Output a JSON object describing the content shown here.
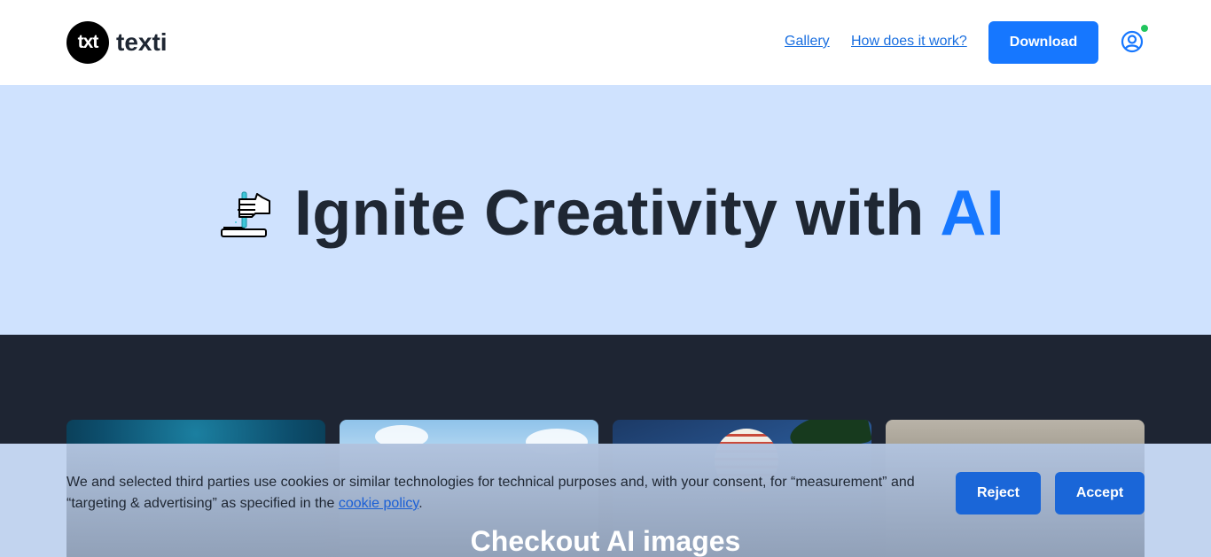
{
  "header": {
    "logo_badge": "txt",
    "logo_name": "texti",
    "nav": {
      "gallery_label": "Gallery",
      "how_label": "How does it work?"
    },
    "download_label": "Download",
    "user_icon": "user-circle-icon",
    "status_color": "#22c55e"
  },
  "hero": {
    "title_main": "Ignite Creativity with ",
    "title_accent": "AI",
    "icon": "hand-writing-icon"
  },
  "gallery": {
    "heading": "Checkout AI images"
  },
  "cookie_banner": {
    "text_before_link": "We and selected third parties use cookies or similar technologies for technical purposes and, with your consent, for “measurement” and “targeting & advertising” as specified in the ",
    "link_label": "cookie policy",
    "text_after_link": ".",
    "reject_label": "Reject",
    "accept_label": "Accept"
  },
  "colors": {
    "accent": "#1677ff",
    "hero_bg": "#cfe2fe",
    "dark_bg": "#1e2533",
    "text_dark": "#1f2733"
  }
}
